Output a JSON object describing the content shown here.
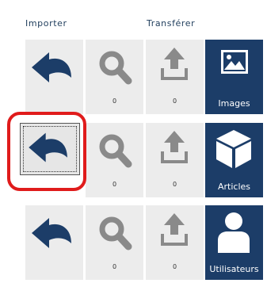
{
  "headers": {
    "import": "Importer",
    "transfer": "Transférer"
  },
  "rows": [
    {
      "search_count": "0",
      "upload_count": "0",
      "entity_label": "Images",
      "entity_icon": "image-icon"
    },
    {
      "search_count": "0",
      "upload_count": "0",
      "entity_label": "Articles",
      "entity_icon": "cube-icon"
    },
    {
      "search_count": "0",
      "upload_count": "0",
      "entity_label": "Utilisateurs",
      "entity_icon": "user-icon"
    }
  ],
  "colors": {
    "accent_blue": "#1c3d68",
    "tile_gray": "#ececec",
    "highlight_red": "#e01b1b",
    "icon_gray": "#8a8a8a"
  }
}
